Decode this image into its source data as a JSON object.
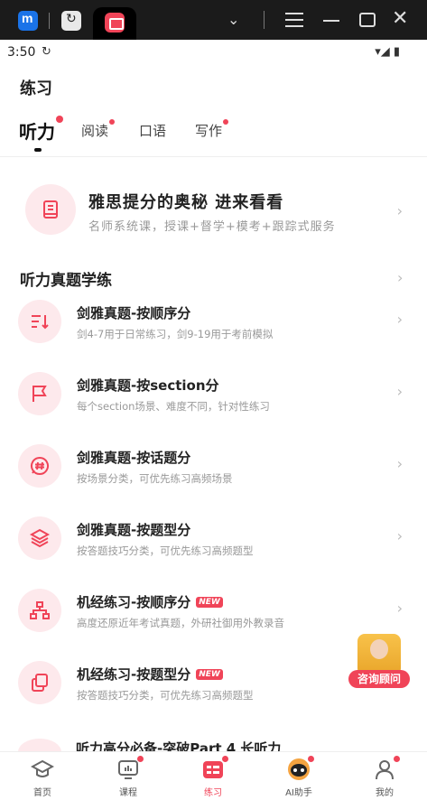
{
  "status": {
    "time": "3:50",
    "signal_text": "▾◢ ▮"
  },
  "page": {
    "title": "练习"
  },
  "tabs": [
    {
      "label": "听力",
      "dot": true
    },
    {
      "label": "阅读",
      "dot": true
    },
    {
      "label": "口语",
      "dot": false
    },
    {
      "label": "写作",
      "dot": true
    }
  ],
  "promo": {
    "title": "雅思提分的奥秘 进来看看",
    "subtitle": "名师系统课，授课+督学+模考+跟踪式服务",
    "icon": "book-icon"
  },
  "section": {
    "title": "听力真题学练"
  },
  "items": [
    {
      "title": "剑雅真题-按顺序分",
      "subtitle": "剑4-7用于日常练习，剑9-19用于考前模拟",
      "icon": "sort-icon",
      "badge": ""
    },
    {
      "title": "剑雅真题-按section分",
      "subtitle": "每个section场景、难度不同，针对性练习",
      "icon": "flag-icon",
      "badge": ""
    },
    {
      "title": "剑雅真题-按话题分",
      "subtitle": "按场景分类，可优先练习高频场景",
      "icon": "hash-icon",
      "badge": ""
    },
    {
      "title": "剑雅真题-按题型分",
      "subtitle": "按答题技巧分类，可优先练习高频题型",
      "icon": "layers-icon",
      "badge": ""
    },
    {
      "title": "机经练习-按顺序分",
      "subtitle": "高度还原近年考试真题，外研社御用外教录音",
      "icon": "hierarchy-icon",
      "badge": "NEW"
    },
    {
      "title": "机经练习-按题型分",
      "subtitle": "按答题技巧分类，可优先练习高频题型",
      "icon": "copy-icon",
      "badge": "NEW"
    }
  ],
  "partial_item": {
    "title": "听力高分必备-突破Part 4 长听力"
  },
  "consult": {
    "label": "咨询顾问"
  },
  "nav": [
    {
      "label": "首页",
      "icon": "graduation-cap-icon",
      "dot": false
    },
    {
      "label": "课程",
      "icon": "tv-icon",
      "dot": true
    },
    {
      "label": "练习",
      "icon": "practice-icon",
      "dot": true
    },
    {
      "label": "AI助手",
      "icon": "robot-icon",
      "dot": true
    },
    {
      "label": "我的",
      "icon": "user-icon",
      "dot": true
    }
  ],
  "colors": {
    "accent": "#f04458",
    "icon_bg": "#fde9ec"
  }
}
